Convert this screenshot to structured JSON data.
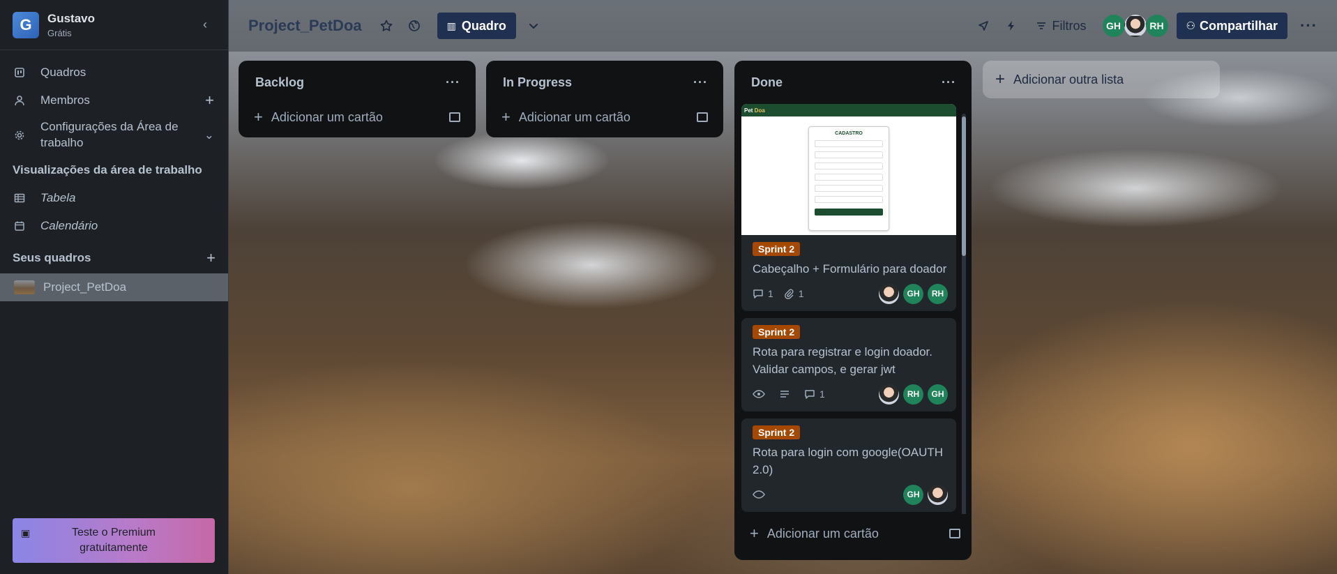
{
  "workspace": {
    "initial": "G",
    "name": "Gustavo",
    "plan": "Grátis"
  },
  "sidebar": {
    "items": [
      {
        "label": "Quadros",
        "icon": "board-icon"
      },
      {
        "label": "Membros",
        "icon": "member-icon"
      },
      {
        "label": "Configurações da Área de trabalho",
        "icon": "gear-icon"
      }
    ],
    "views_title": "Visualizações da área de trabalho",
    "views": [
      {
        "label": "Tabela",
        "icon": "table-icon"
      },
      {
        "label": "Calendário",
        "icon": "calendar-icon"
      }
    ],
    "boards_title": "Seus quadros",
    "boards": [
      {
        "label": "Project_PetDoa"
      }
    ],
    "premium_label": "Teste o Premium gratuitamente"
  },
  "header": {
    "board_title": "Project_PetDoa",
    "view_label": "Quadro",
    "filter_label": "Filtros",
    "members": [
      "GH",
      "RH"
    ],
    "share_label": "Compartilhar"
  },
  "lists": [
    {
      "title": "Backlog",
      "add_card_label": "Adicionar um cartão"
    },
    {
      "title": "In Progress",
      "add_card_label": "Adicionar um cartão"
    },
    {
      "title": "Done",
      "add_card_label": "Adicionar um cartão",
      "cover_text": {
        "logo_a": "Pet ",
        "logo_b": "Doa",
        "form_title": "CADASTRO"
      },
      "cards": [
        {
          "label": "Sprint 2",
          "title": "Cabeçalho + Formulário para doador",
          "comments": "1",
          "attachments": "1",
          "members": [
            "GH",
            "RH"
          ]
        },
        {
          "label": "Sprint 2",
          "title": "Rota para registrar e login doador. Validar campos, e gerar jwt",
          "comments": "1",
          "members": [
            "RH",
            "GH"
          ]
        },
        {
          "label": "Sprint 2",
          "title": "Rota para login com google(OAUTH 2.0)",
          "members": [
            "GH"
          ]
        }
      ]
    }
  ],
  "add_list_label": "Adicionar outra lista",
  "colors": {
    "label": "#a54800",
    "avatar": "#1f845a",
    "header_button": "#1f3050"
  }
}
